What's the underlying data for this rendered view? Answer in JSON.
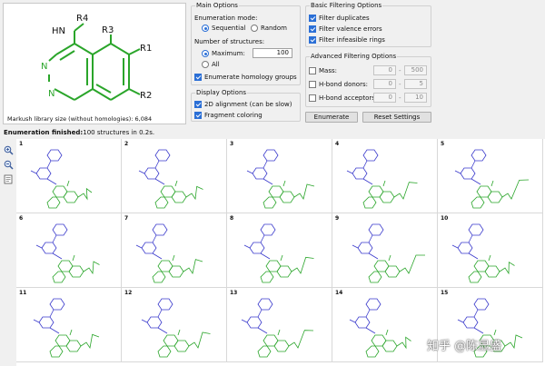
{
  "molecule": {
    "labels": {
      "hn": "HN",
      "r4": "R4",
      "r3": "R3",
      "r1": "R1",
      "r2": "R2",
      "n_top": "N",
      "n_bot": "N"
    },
    "library_size_text": "Markush library size (without homologies): 6,084"
  },
  "main_options": {
    "title": "Main Options",
    "enum_mode_label": "Enumeration mode:",
    "sequential_label": "Sequential",
    "random_label": "Random",
    "num_structures_label": "Number of structures:",
    "maximum_label": "Maximum:",
    "maximum_value": "100",
    "all_label": "All",
    "homology_label": "Enumerate homology groups"
  },
  "display_options": {
    "title": "Display Options",
    "alignment_label": "2D alignment (can be slow)",
    "fragment_label": "Fragment coloring"
  },
  "basic_filtering": {
    "title": "Basic Filtering Options",
    "duplicates_label": "Filter duplicates",
    "valence_label": "Filter valence errors",
    "rings_label": "Filter infeasible rings"
  },
  "advanced_filtering": {
    "title": "Advanced Filtering Options",
    "mass_label": "Mass:",
    "mass_min": "0",
    "mass_max": "500",
    "donors_label": "H-bond donors:",
    "donors_min": "0",
    "donors_max": "5",
    "acceptors_label": "H-bond acceptors:",
    "acceptors_min": "0",
    "acceptors_max": "10",
    "dash": "-"
  },
  "buttons": {
    "enumerate": "Enumerate",
    "reset": "Reset Settings"
  },
  "status": {
    "bold": "Enumeration finished:",
    "rest": " 100 structures in 0.2s."
  },
  "grid": {
    "cells": [
      "1",
      "2",
      "3",
      "4",
      "5",
      "6",
      "7",
      "8",
      "9",
      "10",
      "11",
      "12",
      "13",
      "14",
      "15"
    ]
  },
  "icons": [
    "zoom-in-icon",
    "zoom-out-icon",
    "export-icon"
  ],
  "colors": {
    "green": "#2aa52a",
    "blue": "#3a3acc",
    "accent": "#2b6fd6"
  },
  "watermark": "知乎 @陈显盛"
}
